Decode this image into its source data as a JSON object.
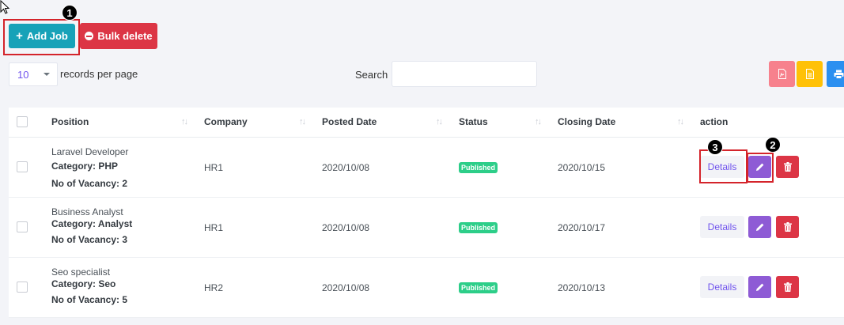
{
  "toolbar": {
    "add_job_label": "Add Job",
    "bulk_delete_label": "Bulk delete",
    "plus_glyph": "+",
    "records_per_page_value": "10",
    "records_per_page_label": "records per page",
    "search_label": "Search",
    "search_value": "",
    "export_buttons": [
      "pdf-icon",
      "excel-icon",
      "print-icon"
    ]
  },
  "callouts": [
    "1",
    "2",
    "3"
  ],
  "table": {
    "headers": [
      "Position",
      "Company",
      "Posted Date",
      "Status",
      "Closing Date",
      "action"
    ],
    "rows": [
      {
        "title": "Laravel Developer",
        "category": "Category: PHP",
        "vacancy": "No of Vacancy: 2",
        "company": "HR1",
        "posted": "2020/10/08",
        "status": "Published",
        "closing": "2020/10/15",
        "details_label": "Details"
      },
      {
        "title": "Business Analyst",
        "category": "Category: Analyst",
        "vacancy": "No of Vacancy: 3",
        "company": "HR1",
        "posted": "2020/10/08",
        "status": "Published",
        "closing": "2020/10/17",
        "details_label": "Details"
      },
      {
        "title": "Seo specialist",
        "category": "Category: Seo",
        "vacancy": "No of Vacancy: 5",
        "company": "HR2",
        "posted": "2020/10/08",
        "status": "Published",
        "closing": "2020/10/13",
        "details_label": "Details"
      }
    ]
  },
  "colors": {
    "add_job": "#17a2b8",
    "bulk_delete": "#dc3545",
    "published": "#2dce89",
    "edit": "#8e5bd5",
    "accent": "#6f52ed",
    "callout": "#d4242b"
  }
}
